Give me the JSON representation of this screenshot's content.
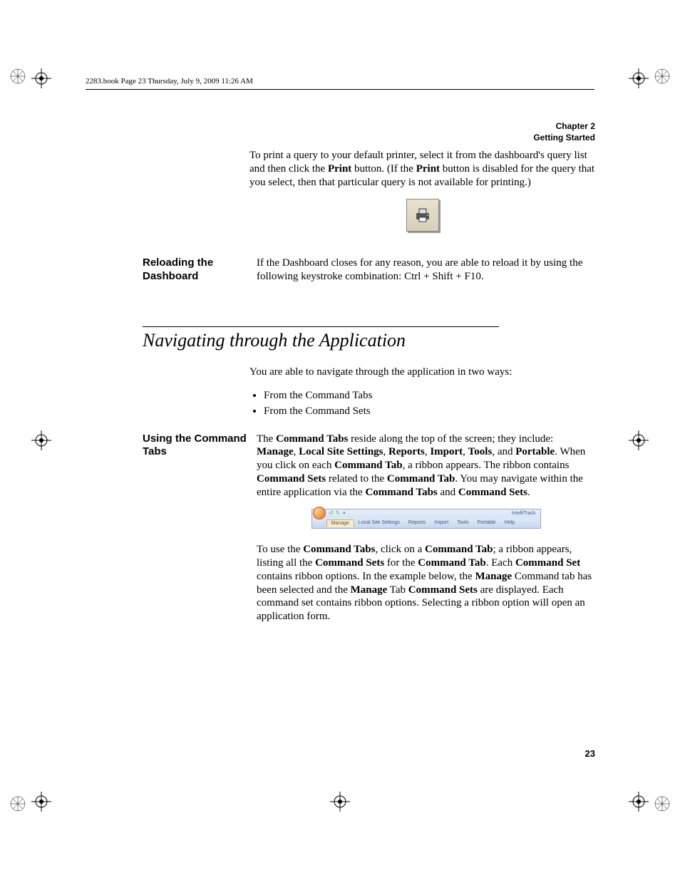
{
  "header": {
    "runner": "2283.book  Page 23  Thursday, July 9, 2009  11:26 AM",
    "chapter_label": "Chapter 2",
    "chapter_title": "Getting Started"
  },
  "intro": {
    "para1_pre": "To print a query to your default printer, select it from the dashboard's query list and then click the ",
    "print1": "Print",
    "para1_mid": " button. (If the ",
    "print2": "Print",
    "para1_post": " button is disabled for the query that you select, then that particular query is not available for printing.)"
  },
  "reloading": {
    "heading": "Reloading the Dashboard",
    "body_pre": "If the Dashboard closes for any reason, you are able to reload it by using the following keystroke combination: ",
    "keystroke": "Ctrl + Shift + F10",
    "body_post": "."
  },
  "section": {
    "title": "Navigating through the Application",
    "lead": "You are able to navigate through the application in two ways:",
    "bullets": [
      "From the Command Tabs",
      "From the Command Sets"
    ]
  },
  "using_tabs": {
    "heading": "Using the Command Tabs",
    "p1": {
      "t0": "The ",
      "b0": "Command Tabs",
      "t1": " reside along the top of the screen; they include: ",
      "b1": "Manage",
      "c1": ", ",
      "b2": "Local Site Settings",
      "c2": ", ",
      "b3": "Reports",
      "c3": ", ",
      "b4": "Import",
      "c4": ", ",
      "b5": "Tools",
      "c5": ", and ",
      "b6": "Portable",
      "t2": ". When you click on each ",
      "b7": "Command Tab",
      "t3": ", a ribbon appears. The ribbon contains ",
      "b8": "Command Sets",
      "t4": " related to the ",
      "b9": "Command Tab",
      "t5": ". You may navigate within the entire application via the ",
      "b10": "Command Tabs",
      "t6": " and ",
      "b11": "Command Sets",
      "t7": "."
    },
    "p2": {
      "t0": "To use the ",
      "b0": "Command Tabs",
      "t1": ", click on a ",
      "b1": "Command Tab",
      "t2": "; a ribbon appears, listing all the ",
      "b2": "Command Sets",
      "t3": " for the ",
      "b3": "Command Tab",
      "t4": ". Each ",
      "b4": "Command Set",
      "t5": " contains ribbon options. In the example below, the ",
      "b5": "Manage",
      "t6": " Command tab has been selected and the ",
      "b6": "Manage",
      "t7": " Tab ",
      "b7": "Command Sets",
      "t8": " are displayed. Each command set contains ribbon options. Selecting a ribbon option will open an application form."
    }
  },
  "ribbon": {
    "app_title": "IntelliTrack",
    "tabs": [
      "Manage",
      "Local Site Settings",
      "Reports",
      "Import",
      "Tools",
      "Portable",
      "Help"
    ]
  },
  "page_number": "23"
}
